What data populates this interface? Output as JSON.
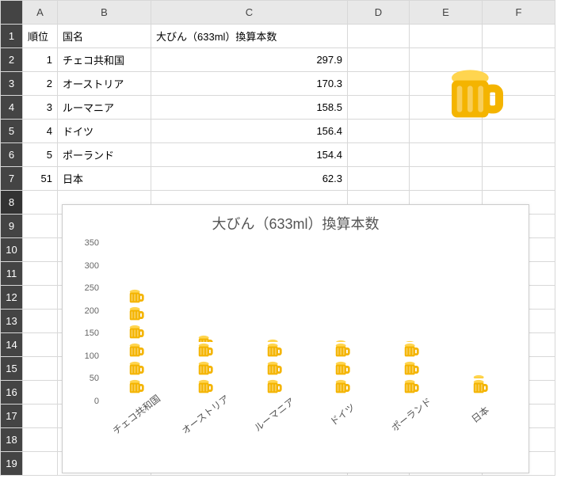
{
  "columns": [
    "A",
    "B",
    "C",
    "D",
    "E",
    "F"
  ],
  "rowHeaders": [
    1,
    2,
    3,
    4,
    5,
    6,
    7,
    8,
    9,
    10,
    11,
    12,
    13,
    14,
    15,
    16,
    17,
    18,
    19
  ],
  "headers": {
    "A": "順位",
    "B": "国名",
    "C": "大びん（633ml）換算本数"
  },
  "rows": [
    {
      "rank": 1,
      "country": "チェコ共和国",
      "value": 297.9
    },
    {
      "rank": 2,
      "country": "オーストリア",
      "value": 170.3
    },
    {
      "rank": 3,
      "country": "ルーマニア",
      "value": 158.5
    },
    {
      "rank": 4,
      "country": "ドイツ",
      "value": 156.4
    },
    {
      "rank": 5,
      "country": "ポーランド",
      "value": 154.4
    },
    {
      "rank": 51,
      "country": "日本",
      "value": 62.3
    }
  ],
  "chart_data": {
    "type": "bar",
    "title": "大びん（633ml）換算本数",
    "categories": [
      "チェコ共和国",
      "オーストリア",
      "ルーマニア",
      "ドイツ",
      "ポーランド",
      "日本"
    ],
    "values": [
      297.9,
      170.3,
      158.5,
      156.4,
      154.4,
      62.3
    ],
    "xlabel": "",
    "ylabel": "",
    "ylim": [
      0,
      350
    ],
    "yticks": [
      0,
      50,
      100,
      150,
      200,
      250,
      300,
      350
    ],
    "marker": "beer-mug-icon",
    "marker_unit": 50
  },
  "decor": {
    "name": "beer-mug-icon"
  }
}
